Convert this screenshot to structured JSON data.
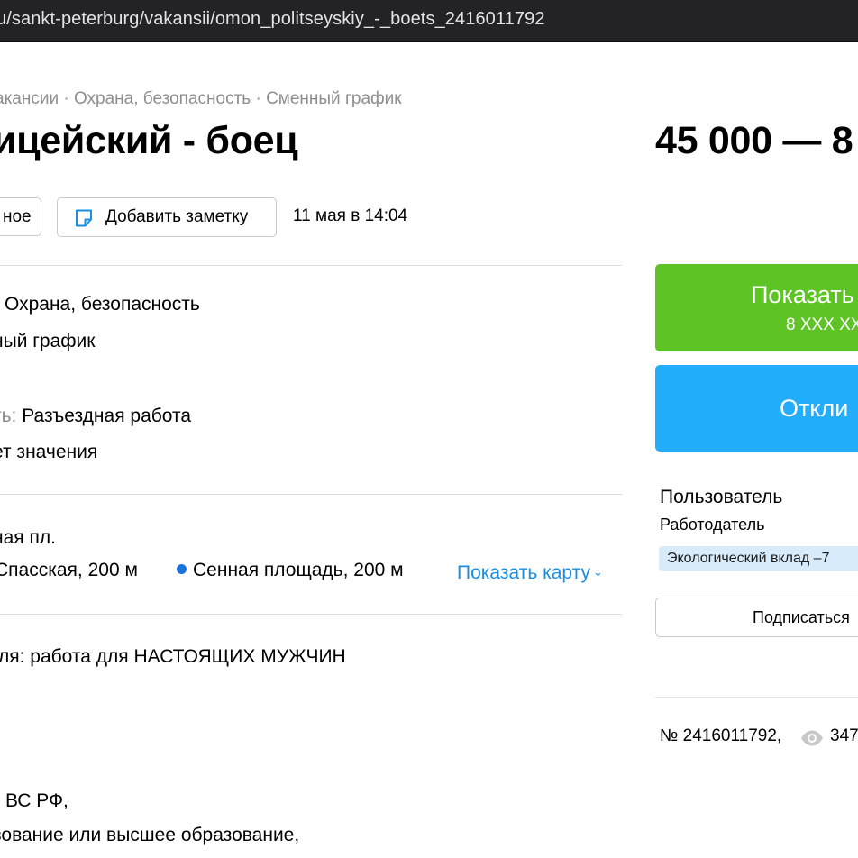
{
  "browser": {
    "url_visible": "u/sankt-peterburg/vakansii/omon_politseyskiy_-_boets_2416011792"
  },
  "breadcrumbs": "акансии · Охрана, безопасность · Сменный график",
  "listing": {
    "title": "ицейский - боец",
    "price": "45 000 — 8",
    "favorite_label": "ное",
    "add_note_label": "Добавить заметку",
    "date": "11 мая в 14:04"
  },
  "params": {
    "line1": "Охрана, безопасность",
    "line2": "ный график",
    "line3_label": "ть:",
    "line3_value": "Разъездная работа",
    "line4": "ет значения"
  },
  "location": {
    "address": "ная пл.",
    "metro1": "Спасская, 200 м",
    "metro2": "Сенная площадь, 200 м",
    "metro_line_color": "#1a73d9",
    "show_map": "Показать карту"
  },
  "description": {
    "line1": "ля: работа для НАСТОЯЩИХ МУЖЧИН",
    "line2": "ВС РФ,",
    "line3": "зование или высшее образование,"
  },
  "sidebar": {
    "show_phone": "Показать",
    "phone_masked": "8 XXX XX",
    "reply": "Откли",
    "seller_name": "Пользователь",
    "seller_role": "Работодатель",
    "badge": "Экологический вклад –7",
    "subscribe": "Подписаться",
    "ad_number": "№ 2416011792,",
    "views": "347"
  },
  "colors": {
    "phone_button": "#5ec425",
    "reply_button": "#24adfb",
    "link": "#1a8fe0",
    "badge_bg": "#d8ebfb"
  }
}
